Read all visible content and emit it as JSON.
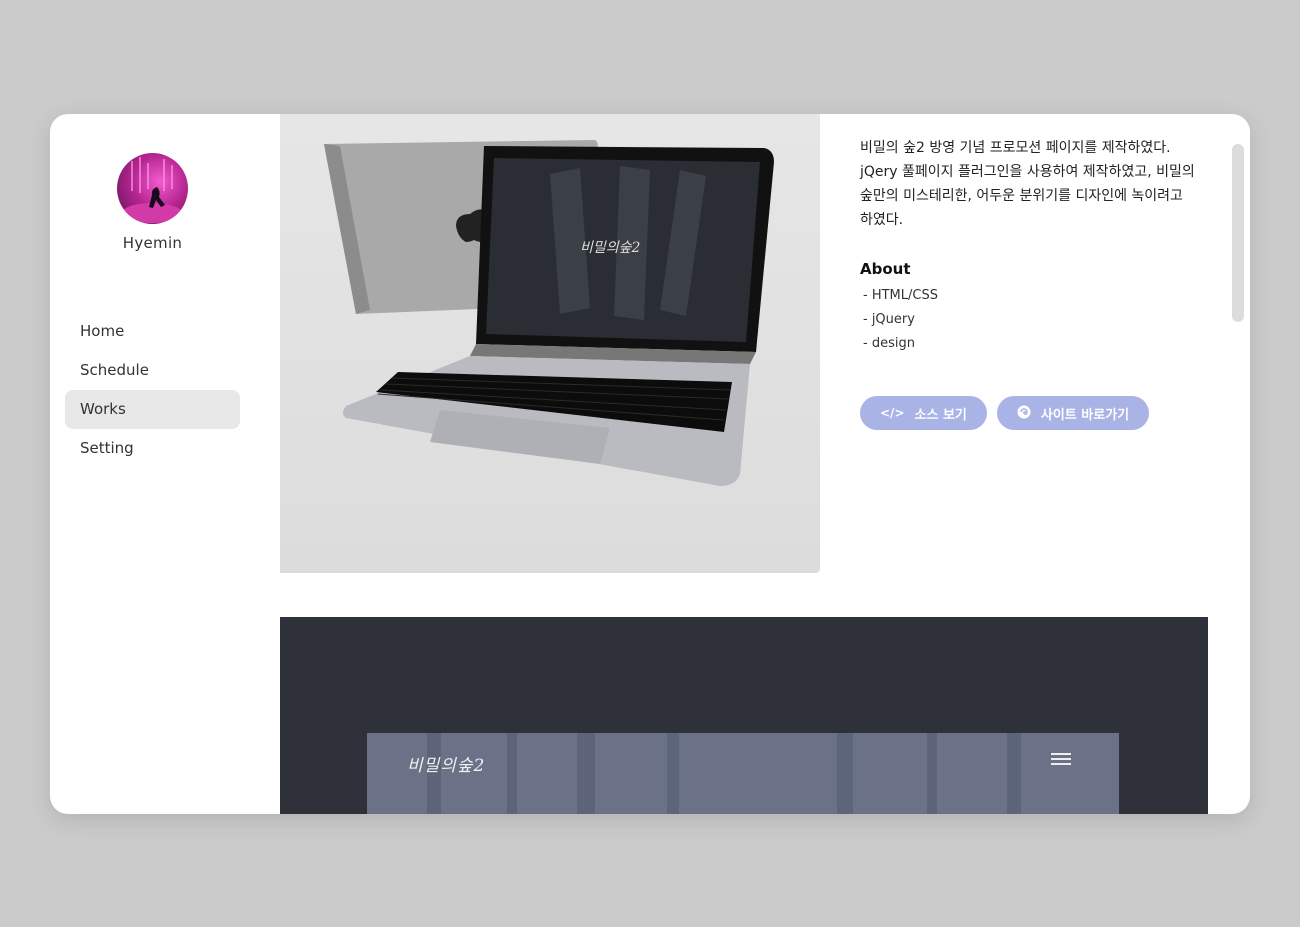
{
  "sidebar": {
    "username": "Hyemin",
    "nav": [
      {
        "label": "Home"
      },
      {
        "label": "Schedule"
      },
      {
        "label": "Works"
      },
      {
        "label": "Setting"
      }
    ]
  },
  "work": {
    "description": "비밀의 숲2 방영 기념 프로모션 페이지를 제작하였다. jQery 풀페이지 플러그인을 사용하여 제작하였고, 비밀의 숲만의 미스테리한, 어두운 분위기를 디자인에 녹이려고 하였다.",
    "about_title": "About",
    "about_items": [
      "- HTML/CSS",
      "- jQuery",
      "- design"
    ],
    "buttons": {
      "source": "소스 보기",
      "site": "사이트 바로가기"
    },
    "preview_logo": "비밀의숲2"
  },
  "colors": {
    "accent": "#a9b3e6",
    "active_nav": "#e8e8e8",
    "background": "#cbcbcb"
  }
}
